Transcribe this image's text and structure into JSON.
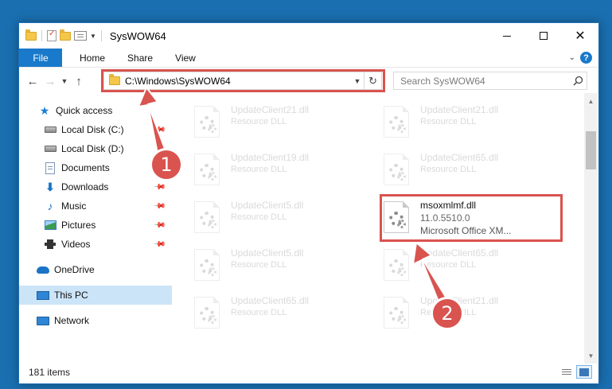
{
  "window": {
    "title": "SysWOW64",
    "minimize_icon": "minimize-icon",
    "maximize_icon": "maximize-icon",
    "close_icon": "close-icon"
  },
  "ribbon": {
    "tabs": [
      "File",
      "Home",
      "Share",
      "View"
    ],
    "help_glyph": "?",
    "accent": "#1979ca"
  },
  "nav": {
    "address": "C:\\Windows\\SysWOW64",
    "search_placeholder": "Search SysWOW64"
  },
  "sidebar": {
    "items": [
      {
        "label": "Quick access",
        "icon": "star-icon"
      },
      {
        "label": "Local Disk (C:)",
        "icon": "drive-icon"
      },
      {
        "label": "Local Disk (D:)",
        "icon": "drive-icon"
      },
      {
        "label": "Documents",
        "icon": "documents-icon"
      },
      {
        "label": "Downloads",
        "icon": "download-icon"
      },
      {
        "label": "Music",
        "icon": "music-icon"
      },
      {
        "label": "Pictures",
        "icon": "pictures-icon"
      },
      {
        "label": "Videos",
        "icon": "videos-icon"
      },
      {
        "label": "OneDrive",
        "icon": "cloud-icon"
      },
      {
        "label": "This PC",
        "icon": "computer-icon"
      },
      {
        "label": "Network",
        "icon": "network-icon"
      }
    ]
  },
  "files": [
    {
      "name": "UpdateClient21.dll",
      "desc": "Resource DLL"
    },
    {
      "name": "UpdateClient21.dll",
      "desc": "Resource DLL"
    },
    {
      "name": "UpdateClient19.dll",
      "desc": "Resource DLL"
    },
    {
      "name": "UpdateClient65.dll",
      "desc": "Resource DLL"
    },
    {
      "name": "UpdateClient5.dll",
      "desc": "Resource DLL"
    },
    {
      "name": "msoxmlmf.dll",
      "version": "11.0.5510.0",
      "desc": "Microsoft Office XM..."
    },
    {
      "name": "UpdateClient5.dll",
      "desc": "Resource DLL"
    },
    {
      "name": "UpdateClient65.dll",
      "desc": "Resource DLL"
    },
    {
      "name": "UpdateClient65.dll",
      "desc": "Resource DLL"
    },
    {
      "name": "UpdateClient21.dll",
      "desc": "Resource DLL"
    }
  ],
  "status": {
    "item_count": "181 items"
  },
  "annotations": {
    "step1": "1",
    "step2": "2",
    "color": "#d9534f"
  }
}
